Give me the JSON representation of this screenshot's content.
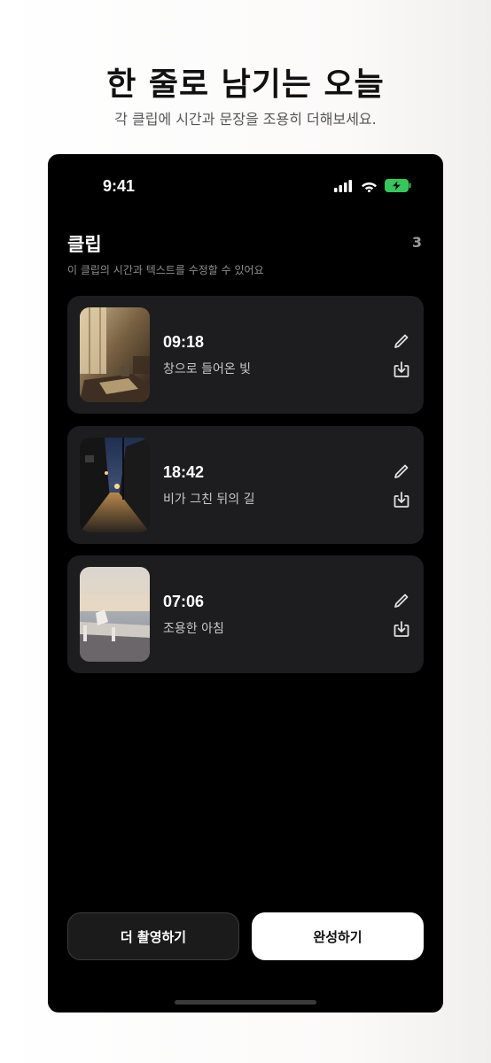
{
  "header": {
    "title": "한 줄로 남기는 오늘",
    "subtitle": "각 클립에 시간과 문장을 조용히 더해보세요."
  },
  "status_bar": {
    "time": "9:41"
  },
  "clips_section": {
    "title": "클립",
    "count": "3",
    "hint": "이 클립의 시간과 텍스트를 수정할 수 있어요"
  },
  "clips": [
    {
      "time": "09:18",
      "text": "창으로 들어온 빛",
      "thumbnail": "window-light-room"
    },
    {
      "time": "18:42",
      "text": "비가 그친 뒤의 길",
      "thumbnail": "rainy-street-night"
    },
    {
      "time": "07:06",
      "text": "조용한 아침",
      "thumbnail": "morning-seaside"
    }
  ],
  "actions": {
    "shoot_more": "더 촬영하기",
    "complete": "완성하기"
  },
  "colors": {
    "background": "#000000",
    "card": "#1d1d1f",
    "battery": "#34c759",
    "primary_button": "#ffffff"
  }
}
